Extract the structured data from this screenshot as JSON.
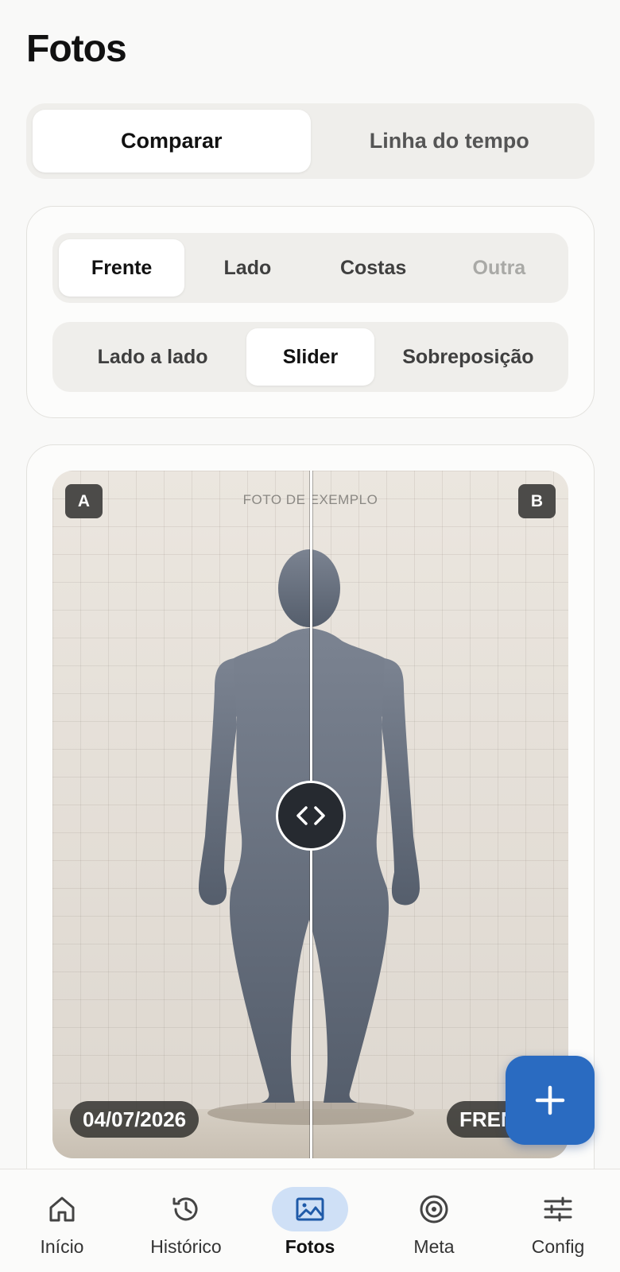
{
  "page": {
    "title": "Fotos"
  },
  "top_tabs": [
    {
      "label": "Comparar",
      "active": true
    },
    {
      "label": "Linha do tempo",
      "active": false
    }
  ],
  "view_options": [
    {
      "label": "Frente",
      "active": true
    },
    {
      "label": "Lado",
      "active": false
    },
    {
      "label": "Costas",
      "active": false
    },
    {
      "label": "Outra",
      "disabled": true
    }
  ],
  "compare_modes": [
    {
      "label": "Lado a lado",
      "active": false
    },
    {
      "label": "Slider",
      "active": true
    },
    {
      "label": "Sobreposição",
      "active": false
    }
  ],
  "photo": {
    "sample_label": "FOTO DE EXEMPLO",
    "corner_a": "A",
    "corner_b": "B",
    "date": "04/07/2026",
    "pose": "FRENTE",
    "slider_position": 0.5
  },
  "fab": {
    "icon": "plus-icon"
  },
  "nav": [
    {
      "label": "Início",
      "icon": "home-icon",
      "active": false
    },
    {
      "label": "Histórico",
      "icon": "history-icon",
      "active": false
    },
    {
      "label": "Fotos",
      "icon": "image-icon",
      "active": true
    },
    {
      "label": "Meta",
      "icon": "target-icon",
      "active": false
    },
    {
      "label": "Config",
      "icon": "sliders-icon",
      "active": false
    }
  ],
  "colors": {
    "accent": "#2a6bc1",
    "nav_active_bg": "#cfe0f6",
    "figure": "#5f6877"
  }
}
